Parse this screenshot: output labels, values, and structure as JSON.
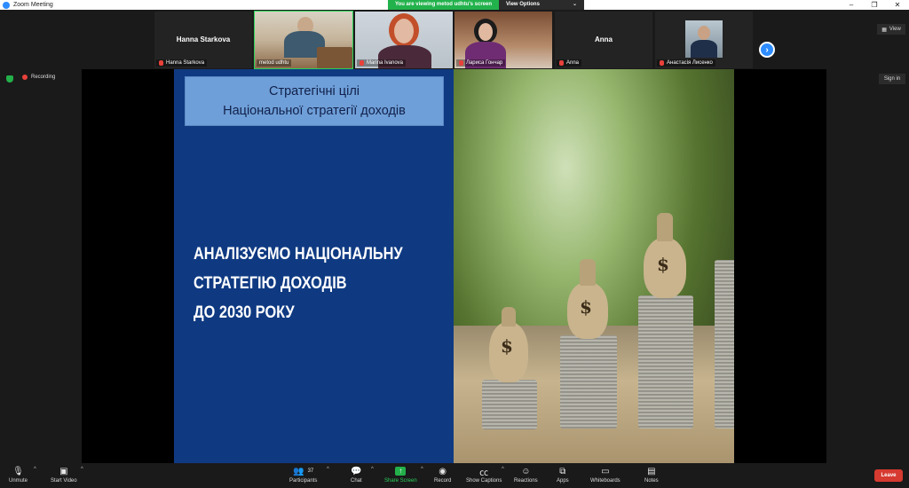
{
  "window": {
    "title": "Zoom Meeting"
  },
  "banner": {
    "viewing_text": "You are viewing metod udhtu's screen",
    "view_options_label": "View Options"
  },
  "gallery": {
    "tiles": [
      {
        "big_name": "Hanna Starkova",
        "tag": "Hanna Starkova"
      },
      {
        "big_name": "",
        "tag": "metod udhtu"
      },
      {
        "big_name": "",
        "tag": "Marina Ivanova"
      },
      {
        "big_name": "",
        "tag": "Лариса Гончар"
      },
      {
        "big_name": "Anna",
        "tag": "Anna"
      },
      {
        "big_name": "",
        "tag": "Анастасія Лисенко"
      }
    ],
    "view_label": "View"
  },
  "status": {
    "recording_label": "Recording",
    "sign_in_label": "Sign in"
  },
  "slide": {
    "title_line1": "Стратегічні цілі",
    "title_line2": "Національної стратегії доходів",
    "main_line1": "АНАЛІЗУЄМО НАЦІОНАЛЬНУ",
    "main_line2": "СТРАТЕГІЮ ДОХОДІВ",
    "main_line3": "ДО 2030 РОКУ"
  },
  "toolbar": {
    "unmute": "Unmute",
    "start_video": "Start Video",
    "participants": "Participants",
    "participants_count": "37",
    "chat": "Chat",
    "share_screen": "Share Screen",
    "record": "Record",
    "show_captions": "Show Captions",
    "reactions": "Reactions",
    "apps": "Apps",
    "whiteboards": "Whiteboards",
    "notes": "Notes",
    "leave": "Leave"
  },
  "colors": {
    "accent": "#2d8cff",
    "share_green": "#23b04a",
    "leave_red": "#d63a30",
    "slide_blue": "#0f3a82"
  }
}
